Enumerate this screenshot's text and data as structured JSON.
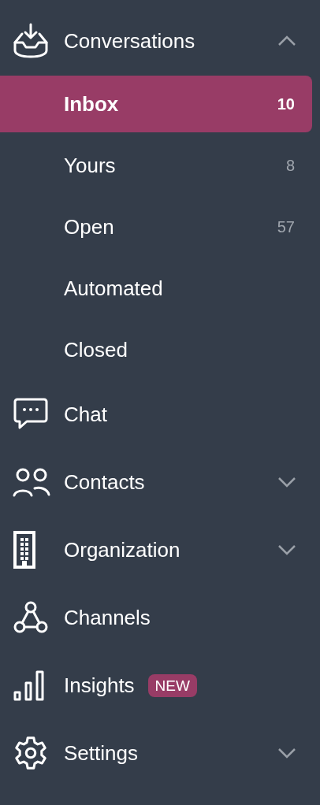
{
  "nav": [
    {
      "label": "Conversations",
      "kind": "inbox",
      "expanded": true,
      "children": [
        {
          "label": "Inbox",
          "count": "10",
          "selected": true
        },
        {
          "label": "Yours",
          "count": "8",
          "selected": false
        },
        {
          "label": "Open",
          "count": "57",
          "selected": false
        },
        {
          "label": "Automated",
          "selected": false
        },
        {
          "label": "Closed",
          "selected": false
        }
      ]
    },
    {
      "label": "Chat",
      "kind": "chat"
    },
    {
      "label": "Contacts",
      "kind": "people",
      "expanded": false
    },
    {
      "label": "Organization",
      "kind": "building",
      "expanded": false
    },
    {
      "label": "Channels",
      "kind": "network"
    },
    {
      "label": "Insights",
      "kind": "bars",
      "badge": "NEW"
    },
    {
      "label": "Settings",
      "kind": "gear",
      "expanded": false
    }
  ]
}
